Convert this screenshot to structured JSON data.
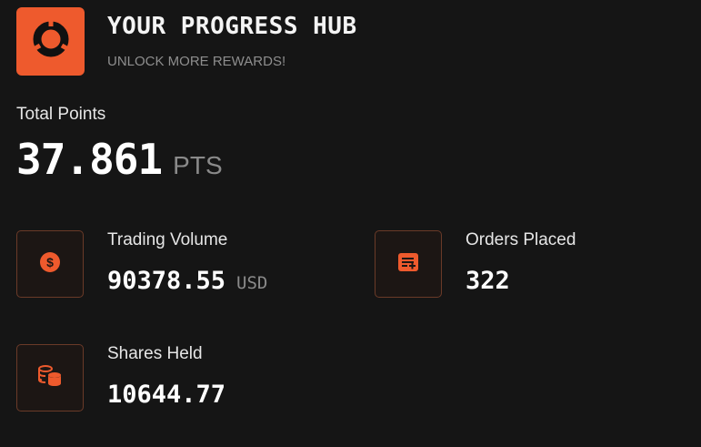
{
  "header": {
    "title": "YOUR PROGRESS HUB",
    "subtitle": "UNLOCK MORE REWARDS!",
    "logo_icon": "ring-logo-icon",
    "brand_color": "#ee5a2d"
  },
  "total": {
    "label": "Total Points",
    "value": "37.861",
    "unit": "PTS"
  },
  "stats": [
    {
      "label": "Trading Volume",
      "value": "90378.55",
      "unit": "USD",
      "icon": "dollar-coin-icon"
    },
    {
      "label": "Orders Placed",
      "value": "322",
      "unit": "",
      "icon": "order-list-icon"
    },
    {
      "label": "Shares Held",
      "value": "10644.77",
      "unit": "",
      "icon": "coin-stack-icon"
    }
  ],
  "colors": {
    "background": "#151515",
    "accent": "#ee5a2d",
    "muted_text": "#8a8a8a"
  }
}
